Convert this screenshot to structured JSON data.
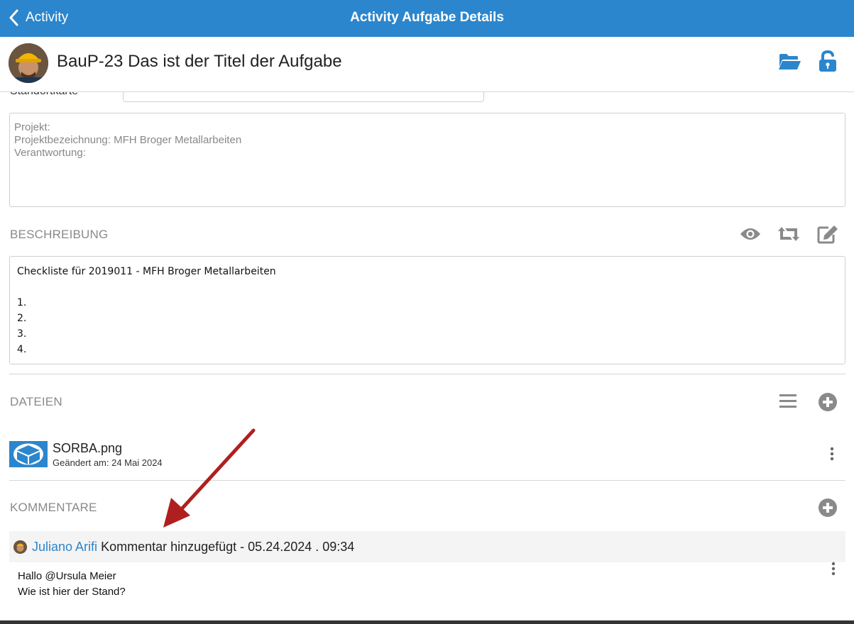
{
  "navbar": {
    "back_label": "Activity",
    "title": "Activity Aufgabe Details"
  },
  "header": {
    "task_title": "BauP-23 Das ist der Titel der Aufgabe"
  },
  "clipped_field": {
    "label": "Standortkarte",
    "value": "Standortkarte"
  },
  "project": {
    "lines": [
      "Projekt:",
      "Projektbezeichnung: MFH Broger Metallarbeiten",
      "Verantwortung:"
    ]
  },
  "description": {
    "section_title": "BESCHREIBUNG",
    "heading": "Checkliste für 2019011 - MFH Broger Metallarbeiten",
    "items": [
      "1.",
      "2.",
      "3.",
      "4."
    ]
  },
  "files": {
    "section_title": "DATEIEN",
    "items": [
      {
        "name": "SORBA.png",
        "meta": "Geändert am: 24 Mai 2024"
      }
    ]
  },
  "comments": {
    "section_title": "KOMMENTARE",
    "items": [
      {
        "author": "Juliano Arifi",
        "action": " Kommentar hinzugefügt - 05.24.2024 . 09:34",
        "lines": [
          "Hallo @Ursula Meier",
          "Wie ist hier der Stand?"
        ]
      }
    ]
  },
  "colors": {
    "brand": "#2b86cd",
    "icon_gray": "#8a8a8a",
    "annotation": "#b01f1f"
  },
  "icons": {
    "back": "chevron-left-icon",
    "folder": "folder-open-icon",
    "lock": "unlock-icon",
    "eye": "eye-icon",
    "sync": "retweet-icon",
    "edit": "edit-icon",
    "list": "list-icon",
    "add": "plus-circle-icon",
    "more": "more-vertical-icon"
  }
}
